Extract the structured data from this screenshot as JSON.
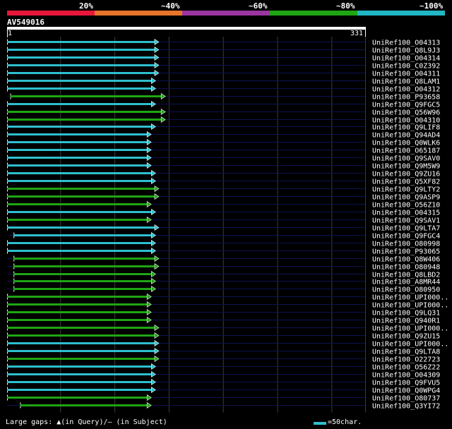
{
  "legend": {
    "labels": [
      "20%",
      "~40%",
      "~60%",
      "~80%",
      "~100%"
    ],
    "colors": [
      "#e8173a",
      "#e8742a",
      "#9b35a0",
      "#1fa514",
      "#21b8c4"
    ]
  },
  "query": {
    "name": "AV549016",
    "start": "1",
    "end": "331",
    "length": 331
  },
  "footer": {
    "gaps_text": "Large gaps: ▲(in Query)/— (in Subject)",
    "scale_text": "=50char."
  },
  "chart_data": {
    "type": "bar",
    "xlim": [
      1,
      331
    ],
    "hits": [
      {
        "name": "UniRef100_O04313",
        "start": 1,
        "end": 137,
        "color": "cyan"
      },
      {
        "name": "UniRef100_Q8L9J3",
        "start": 1,
        "end": 137,
        "color": "cyan"
      },
      {
        "name": "UniRef100_O04314",
        "start": 1,
        "end": 137,
        "color": "cyan"
      },
      {
        "name": "UniRef100_C0Z392",
        "start": 1,
        "end": 137,
        "color": "cyan"
      },
      {
        "name": "UniRef100_O04311",
        "start": 1,
        "end": 137,
        "color": "cyan"
      },
      {
        "name": "UniRef100_Q8LAM1",
        "start": 1,
        "end": 134,
        "color": "cyan"
      },
      {
        "name": "UniRef100_O04312",
        "start": 1,
        "end": 134,
        "color": "cyan"
      },
      {
        "name": "UniRef100_P93658",
        "start": 4,
        "end": 143,
        "color": "green"
      },
      {
        "name": "UniRef100_Q9FGC5",
        "start": 1,
        "end": 134,
        "color": "cyan"
      },
      {
        "name": "UniRef100_Q56W96",
        "start": 1,
        "end": 143,
        "color": "green"
      },
      {
        "name": "UniRef100_O04310",
        "start": 1,
        "end": 143,
        "color": "green"
      },
      {
        "name": "UniRef100_Q9LIF8",
        "start": 1,
        "end": 134,
        "color": "cyan"
      },
      {
        "name": "UniRef100_Q94AD4",
        "start": 1,
        "end": 130,
        "color": "cyan"
      },
      {
        "name": "UniRef100_Q0WLK6",
        "start": 1,
        "end": 130,
        "color": "cyan"
      },
      {
        "name": "UniRef100_O65187",
        "start": 1,
        "end": 130,
        "color": "cyan"
      },
      {
        "name": "UniRef100_Q9SAV0",
        "start": 1,
        "end": 130,
        "color": "cyan"
      },
      {
        "name": "UniRef100_Q9M5W9",
        "start": 1,
        "end": 130,
        "color": "cyan"
      },
      {
        "name": "UniRef100_Q9ZU16",
        "start": 1,
        "end": 134,
        "color": "cyan"
      },
      {
        "name": "UniRef100_Q5XF82",
        "start": 1,
        "end": 134,
        "color": "cyan"
      },
      {
        "name": "UniRef100_Q9LTY2",
        "start": 1,
        "end": 137,
        "color": "green"
      },
      {
        "name": "UniRef100_Q9ASP9",
        "start": 1,
        "end": 137,
        "color": "green"
      },
      {
        "name": "UniRef100_O56Z10",
        "start": 1,
        "end": 130,
        "color": "green"
      },
      {
        "name": "UniRef100_O04315",
        "start": 1,
        "end": 134,
        "color": "cyan"
      },
      {
        "name": "UniRef100_Q9SAV1",
        "start": 1,
        "end": 130,
        "color": "green"
      },
      {
        "name": "UniRef100_Q9LTA7",
        "start": 1,
        "end": 137,
        "color": "cyan"
      },
      {
        "name": "UniRef100_Q9FGC4",
        "start": 7,
        "end": 134,
        "color": "cyan"
      },
      {
        "name": "UniRef100_O80998",
        "start": 1,
        "end": 134,
        "color": "cyan"
      },
      {
        "name": "UniRef100_P93065",
        "start": 1,
        "end": 134,
        "color": "cyan"
      },
      {
        "name": "UniRef100_Q8W406",
        "start": 7,
        "end": 137,
        "color": "green"
      },
      {
        "name": "UniRef100_O80948",
        "start": 7,
        "end": 137,
        "color": "green"
      },
      {
        "name": "UniRef100_Q8LBD2",
        "start": 7,
        "end": 134,
        "color": "green"
      },
      {
        "name": "UniRef100_A8MR44",
        "start": 7,
        "end": 134,
        "color": "green"
      },
      {
        "name": "UniRef100_O80950",
        "start": 7,
        "end": 134,
        "color": "green"
      },
      {
        "name": "UniRef100_UPI000..",
        "start": 1,
        "end": 130,
        "color": "green"
      },
      {
        "name": "UniRef100_UPI000..",
        "start": 1,
        "end": 130,
        "color": "green"
      },
      {
        "name": "UniRef100_Q9LQ31",
        "start": 1,
        "end": 130,
        "color": "green"
      },
      {
        "name": "UniRef100_Q940R1",
        "start": 1,
        "end": 130,
        "color": "green"
      },
      {
        "name": "UniRef100_UPI000..",
        "start": 1,
        "end": 137,
        "color": "green"
      },
      {
        "name": "UniRef100_Q9ZU15",
        "start": 1,
        "end": 137,
        "color": "green"
      },
      {
        "name": "UniRef100_UPI000..",
        "start": 1,
        "end": 137,
        "color": "cyan"
      },
      {
        "name": "UniRef100_Q9LTA8",
        "start": 1,
        "end": 137,
        "color": "cyan"
      },
      {
        "name": "UniRef100_O22723",
        "start": 1,
        "end": 137,
        "color": "green"
      },
      {
        "name": "UniRef100_O56Z22",
        "start": 1,
        "end": 134,
        "color": "cyan"
      },
      {
        "name": "UniRef100_O04309",
        "start": 1,
        "end": 134,
        "color": "cyan"
      },
      {
        "name": "UniRef100_Q9FVU5",
        "start": 1,
        "end": 134,
        "color": "cyan"
      },
      {
        "name": "UniRef100_Q0WPG4",
        "start": 1,
        "end": 134,
        "color": "cyan"
      },
      {
        "name": "UniRef100_O80737",
        "start": 1,
        "end": 130,
        "color": "green"
      },
      {
        "name": "UniRef100_Q3YI72",
        "start": 13,
        "end": 130,
        "color": "green"
      }
    ],
    "colors": {
      "cyan": "#2ebfcf",
      "green": "#1fa514"
    },
    "gridlines": [
      50,
      100,
      150,
      200,
      250,
      300,
      331
    ]
  }
}
